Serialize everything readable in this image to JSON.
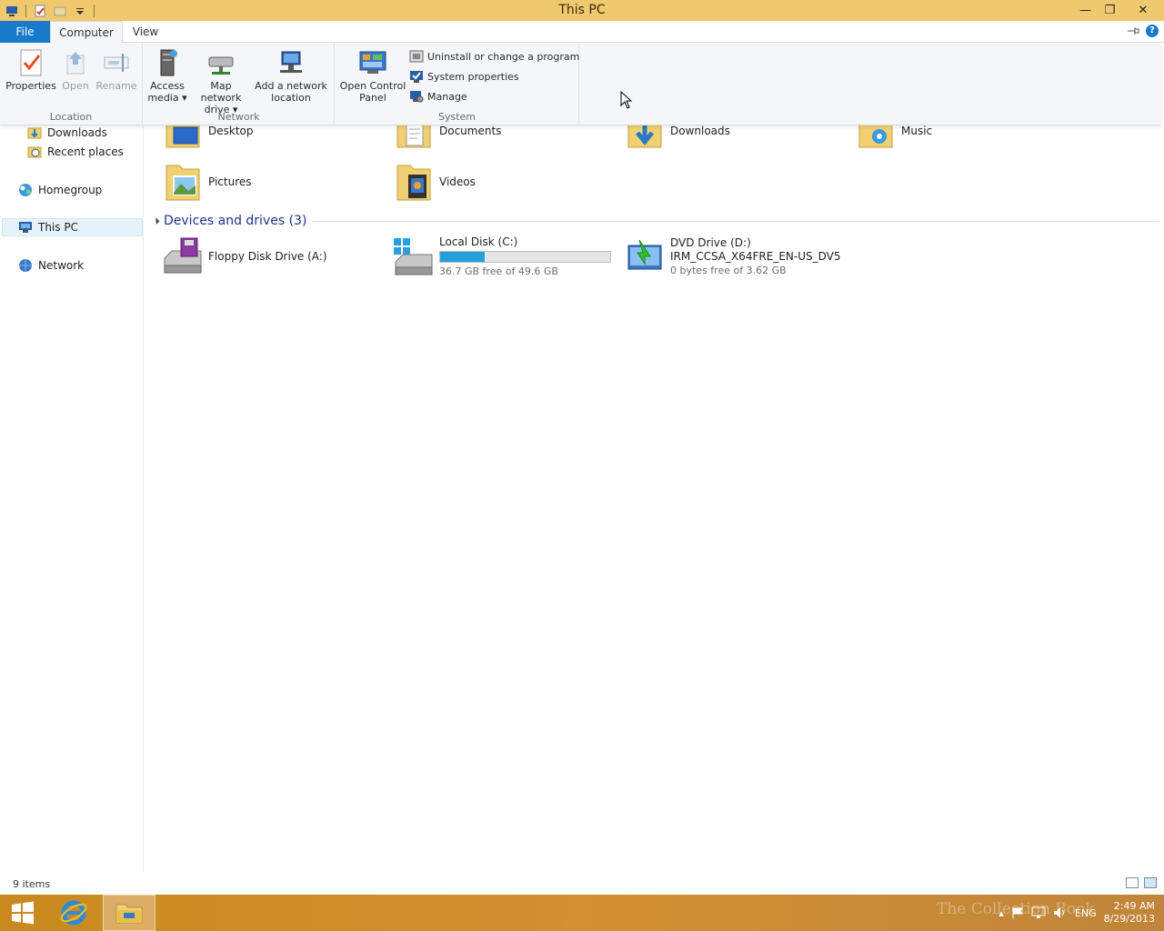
{
  "window": {
    "title": "This PC",
    "buttons": {
      "minimize": "—",
      "restore": "❐",
      "close": "✕"
    }
  },
  "tabs": {
    "file": "File",
    "computer": "Computer",
    "view": "View"
  },
  "ribbon": {
    "location": {
      "label": "Location",
      "properties": "Properties",
      "open": "Open",
      "rename": "Rename"
    },
    "network": {
      "label": "Network",
      "access_media_1": "Access",
      "access_media_2": "media",
      "map_drive_1": "Map network",
      "map_drive_2": "drive",
      "add_location_1": "Add a network",
      "add_location_2": "location"
    },
    "system": {
      "label": "System",
      "control_panel_1": "Open Control",
      "control_panel_2": "Panel",
      "uninstall": "Uninstall or change a program",
      "system_properties": "System properties",
      "manage": "Manage"
    }
  },
  "nav": {
    "items": [
      {
        "label": "Downloads"
      },
      {
        "label": "Recent places"
      },
      {
        "label": "Homegroup"
      },
      {
        "label": "This PC"
      },
      {
        "label": "Network"
      }
    ]
  },
  "folders": [
    {
      "label": "Desktop"
    },
    {
      "label": "Documents"
    },
    {
      "label": "Downloads"
    },
    {
      "label": "Music"
    },
    {
      "label": "Pictures"
    },
    {
      "label": "Videos"
    }
  ],
  "devices": {
    "header": "Devices and drives (3)",
    "floppy": {
      "name": "Floppy Disk Drive (A:)"
    },
    "local": {
      "name": "Local Disk (C:)",
      "free": "36.7 GB free of 49.6 GB",
      "used_fraction": 0.26
    },
    "dvd": {
      "name": "DVD Drive (D:)",
      "label": "IRM_CCSA_X64FRE_EN-US_DV5",
      "free": "0 bytes free of 3.62 GB"
    }
  },
  "status": {
    "items": "9 items"
  },
  "taskbar": {
    "language": "ENG",
    "time": "2:49 AM",
    "date": "8/29/2013",
    "watermark": "The Collection Book"
  },
  "colors": {
    "titlebar": "#f0c86e",
    "accent": "#1979ca",
    "taskbar": "#c88a1e",
    "drive_bar": "#26a0da"
  }
}
